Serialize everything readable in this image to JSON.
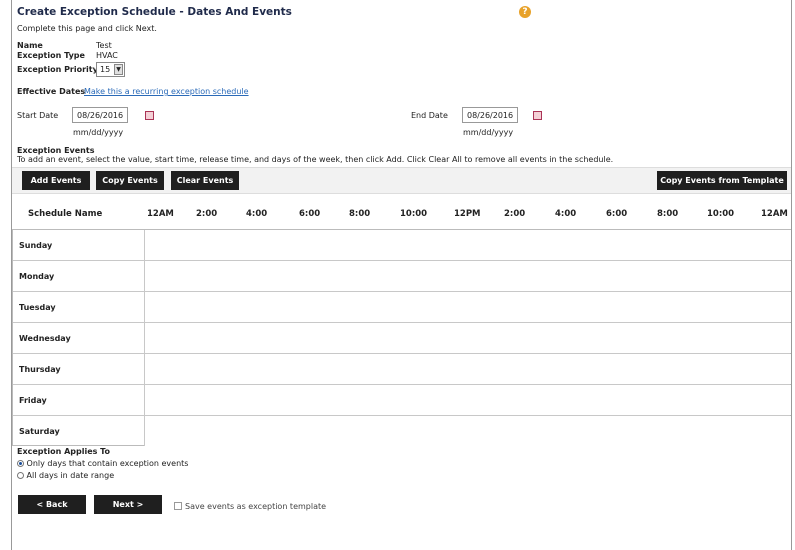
{
  "page": {
    "title": "Create Exception Schedule - Dates And Events",
    "help_glyph": "?",
    "instructions": "Complete this page and click Next."
  },
  "info": {
    "name_label": "Name",
    "name_value": "Test",
    "type_label": "Exception Type",
    "type_value": "HVAC",
    "priority_label": "Exception Priority",
    "priority_value": "15"
  },
  "dates": {
    "effective_label": "Effective Dates",
    "recurring_link": "Make this a recurring exception schedule",
    "start_label": "Start Date",
    "start_value": "08/26/2016",
    "end_label": "End Date",
    "end_value": "08/26/2016",
    "format_hint": "mm/dd/yyyy"
  },
  "events": {
    "heading": "Exception Events",
    "instructions": "To add an event, select the value, start time, release time, and days of the week, then click Add. Click Clear All to remove all events in the schedule.",
    "add_label": "Add Events",
    "copy_label": "Copy Events",
    "clear_label": "Clear Events",
    "template_label": "Copy Events from Template"
  },
  "grid": {
    "schedule_header": "Schedule Name",
    "times": [
      "12AM",
      "2:00",
      "4:00",
      "6:00",
      "8:00",
      "10:00",
      "12PM",
      "2:00",
      "4:00",
      "6:00",
      "8:00",
      "10:00",
      "12AM"
    ],
    "days": [
      "Sunday",
      "Monday",
      "Tuesday",
      "Wednesday",
      "Thursday",
      "Friday",
      "Saturday"
    ]
  },
  "applies": {
    "heading": "Exception Applies To",
    "option1": "Only days that contain exception events",
    "option2": "All days in date range",
    "selected": 1
  },
  "footer": {
    "back_label": "< Back",
    "next_label": "Next >",
    "save_template_label": "Save events as exception template"
  }
}
